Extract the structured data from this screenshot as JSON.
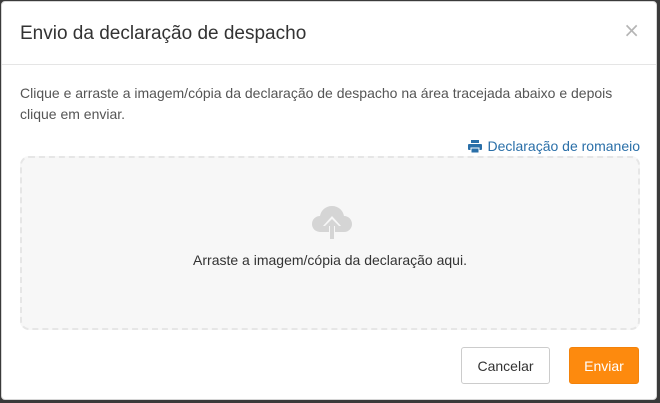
{
  "modal": {
    "title": "Envio da declaração de despacho",
    "close_symbol": "×",
    "instructions": "Clique e arraste a imagem/cópia da declaração de despacho na área tracejada abaixo e depois clique em enviar.",
    "romaneio_link": {
      "icon": "printer-icon",
      "label": "Declaração de romaneio"
    },
    "dropzone": {
      "icon": "cloud-upload-icon",
      "text": "Arraste a imagem/cópia da declaração aqui."
    },
    "buttons": {
      "cancel_label": "Cancelar",
      "send_label": "Enviar"
    }
  },
  "colors": {
    "primary": "#fd8a0e",
    "link": "#2a6fa8",
    "dropzone_bg": "#f7f7f7",
    "dropzone_border": "#e6e6e6"
  }
}
